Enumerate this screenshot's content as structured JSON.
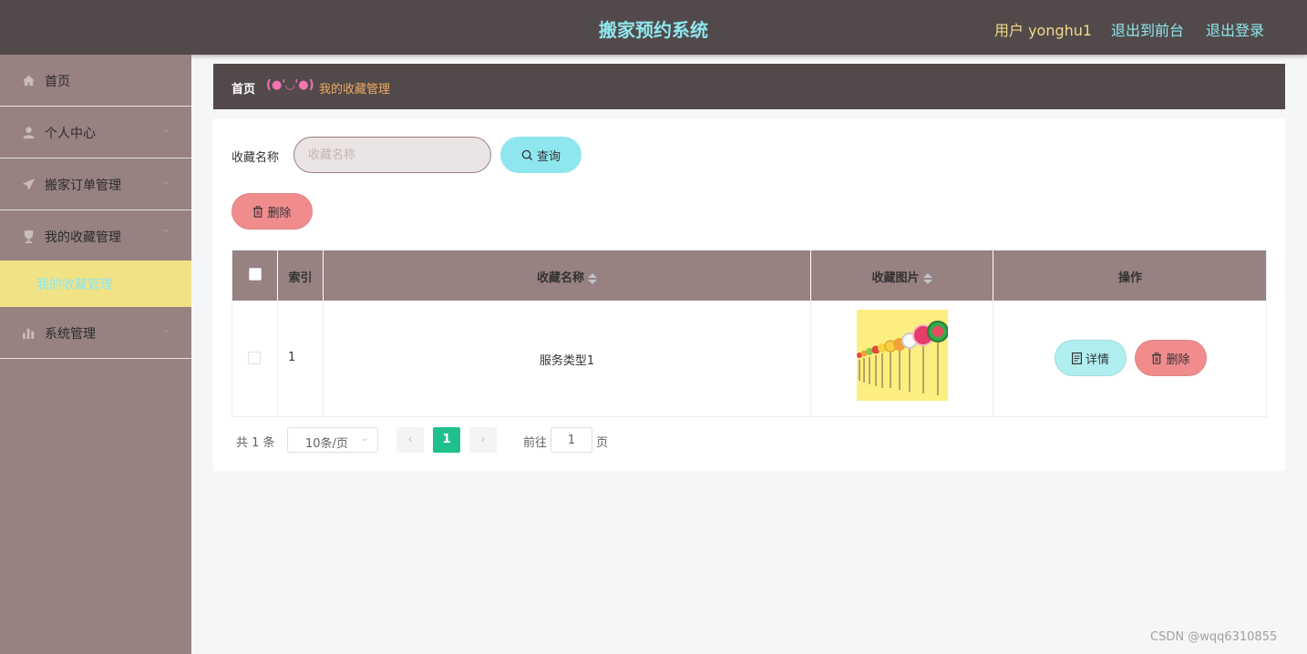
{
  "header": {
    "title": "搬家预约系统",
    "user_label": "用户 yonghu1",
    "back_to_front": "退出到前台",
    "logout": "退出登录"
  },
  "sidebar": {
    "items": [
      {
        "label": "首页",
        "icon": "home-icon"
      },
      {
        "label": "个人中心",
        "icon": "user-icon"
      },
      {
        "label": "搬家订单管理",
        "icon": "send-icon"
      },
      {
        "label": "我的收藏管理",
        "icon": "trophy-icon"
      },
      {
        "label": "系统管理",
        "icon": "bar-chart-icon"
      }
    ],
    "active_sub": "我的收藏管理"
  },
  "breadcrumb": {
    "home": "首页",
    "emoticon": "(●'◡'●)",
    "current": "我的收藏管理"
  },
  "search": {
    "label": "收藏名称",
    "placeholder": "收藏名称",
    "query_button": "查询"
  },
  "toolbar": {
    "delete_label": "删除"
  },
  "table": {
    "headers": [
      "索引",
      "收藏名称",
      "收藏图片",
      "操作"
    ],
    "rows": [
      {
        "index": "1",
        "name": "服务类型1",
        "image": "fruit-lollipops-image"
      }
    ],
    "detail_label": "详情",
    "delete_label": "删除"
  },
  "pagination": {
    "total": "共 1 条",
    "page_size": "10条/页",
    "current_page": "1",
    "goto_label": "前往",
    "goto_value": "1",
    "page_suffix": "页"
  },
  "watermark": "CSDN @wqq6310855",
  "colors": {
    "header_bg": "#524a4a",
    "sidebar_bg": "#978181",
    "accent_cyan": "#8fe6ee",
    "accent_red": "#f08c8c",
    "active_sub_bg": "#f1e385",
    "pager_active": "#1fc08e"
  }
}
